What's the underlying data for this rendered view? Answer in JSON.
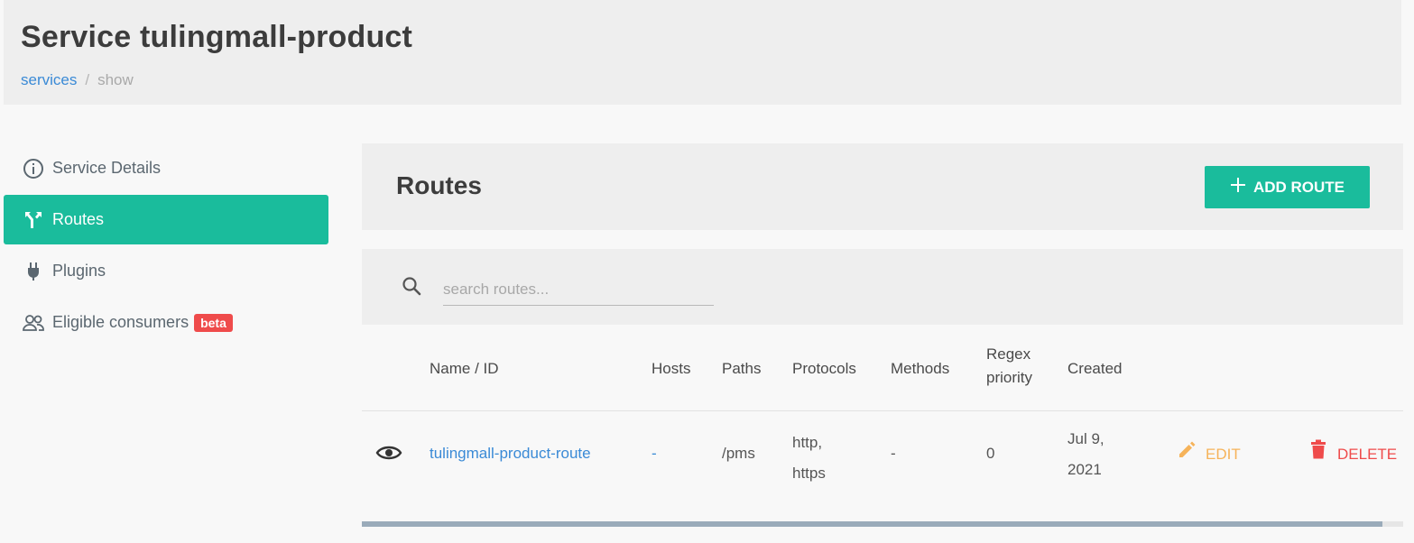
{
  "header": {
    "title": "Service tulingmall-product",
    "breadcrumb": {
      "link": "services",
      "separator": "/",
      "current": "show"
    }
  },
  "sidebar": {
    "items": [
      {
        "label": "Service Details",
        "icon": "info-circle-icon",
        "active": false
      },
      {
        "label": "Routes",
        "icon": "route-split-icon",
        "active": true
      },
      {
        "label": "Plugins",
        "icon": "plug-icon",
        "active": false
      },
      {
        "label": "Eligible consumers",
        "icon": "users-icon",
        "active": false,
        "badge": "beta"
      }
    ]
  },
  "routes": {
    "title": "Routes",
    "add_button": "ADD ROUTE",
    "search_placeholder": "search routes...",
    "columns": [
      "Name / ID",
      "Hosts",
      "Paths",
      "Protocols",
      "Methods",
      "Regex priority",
      "Created"
    ],
    "rows": [
      {
        "name": "tulingmall-product-route",
        "hosts": "-",
        "paths": "/pms",
        "protocols": "http, https",
        "methods": "-",
        "regex_priority": "0",
        "created": "Jul 9, 2021",
        "edit_label": "EDIT",
        "delete_label": "DELETE"
      }
    ],
    "scroll_position": 0.98
  },
  "colors": {
    "accent": "#1abc9c",
    "link": "#3a8ad6",
    "edit": "#f6b35a",
    "delete": "#ef4b4b",
    "badge": "#ef4b4b"
  }
}
